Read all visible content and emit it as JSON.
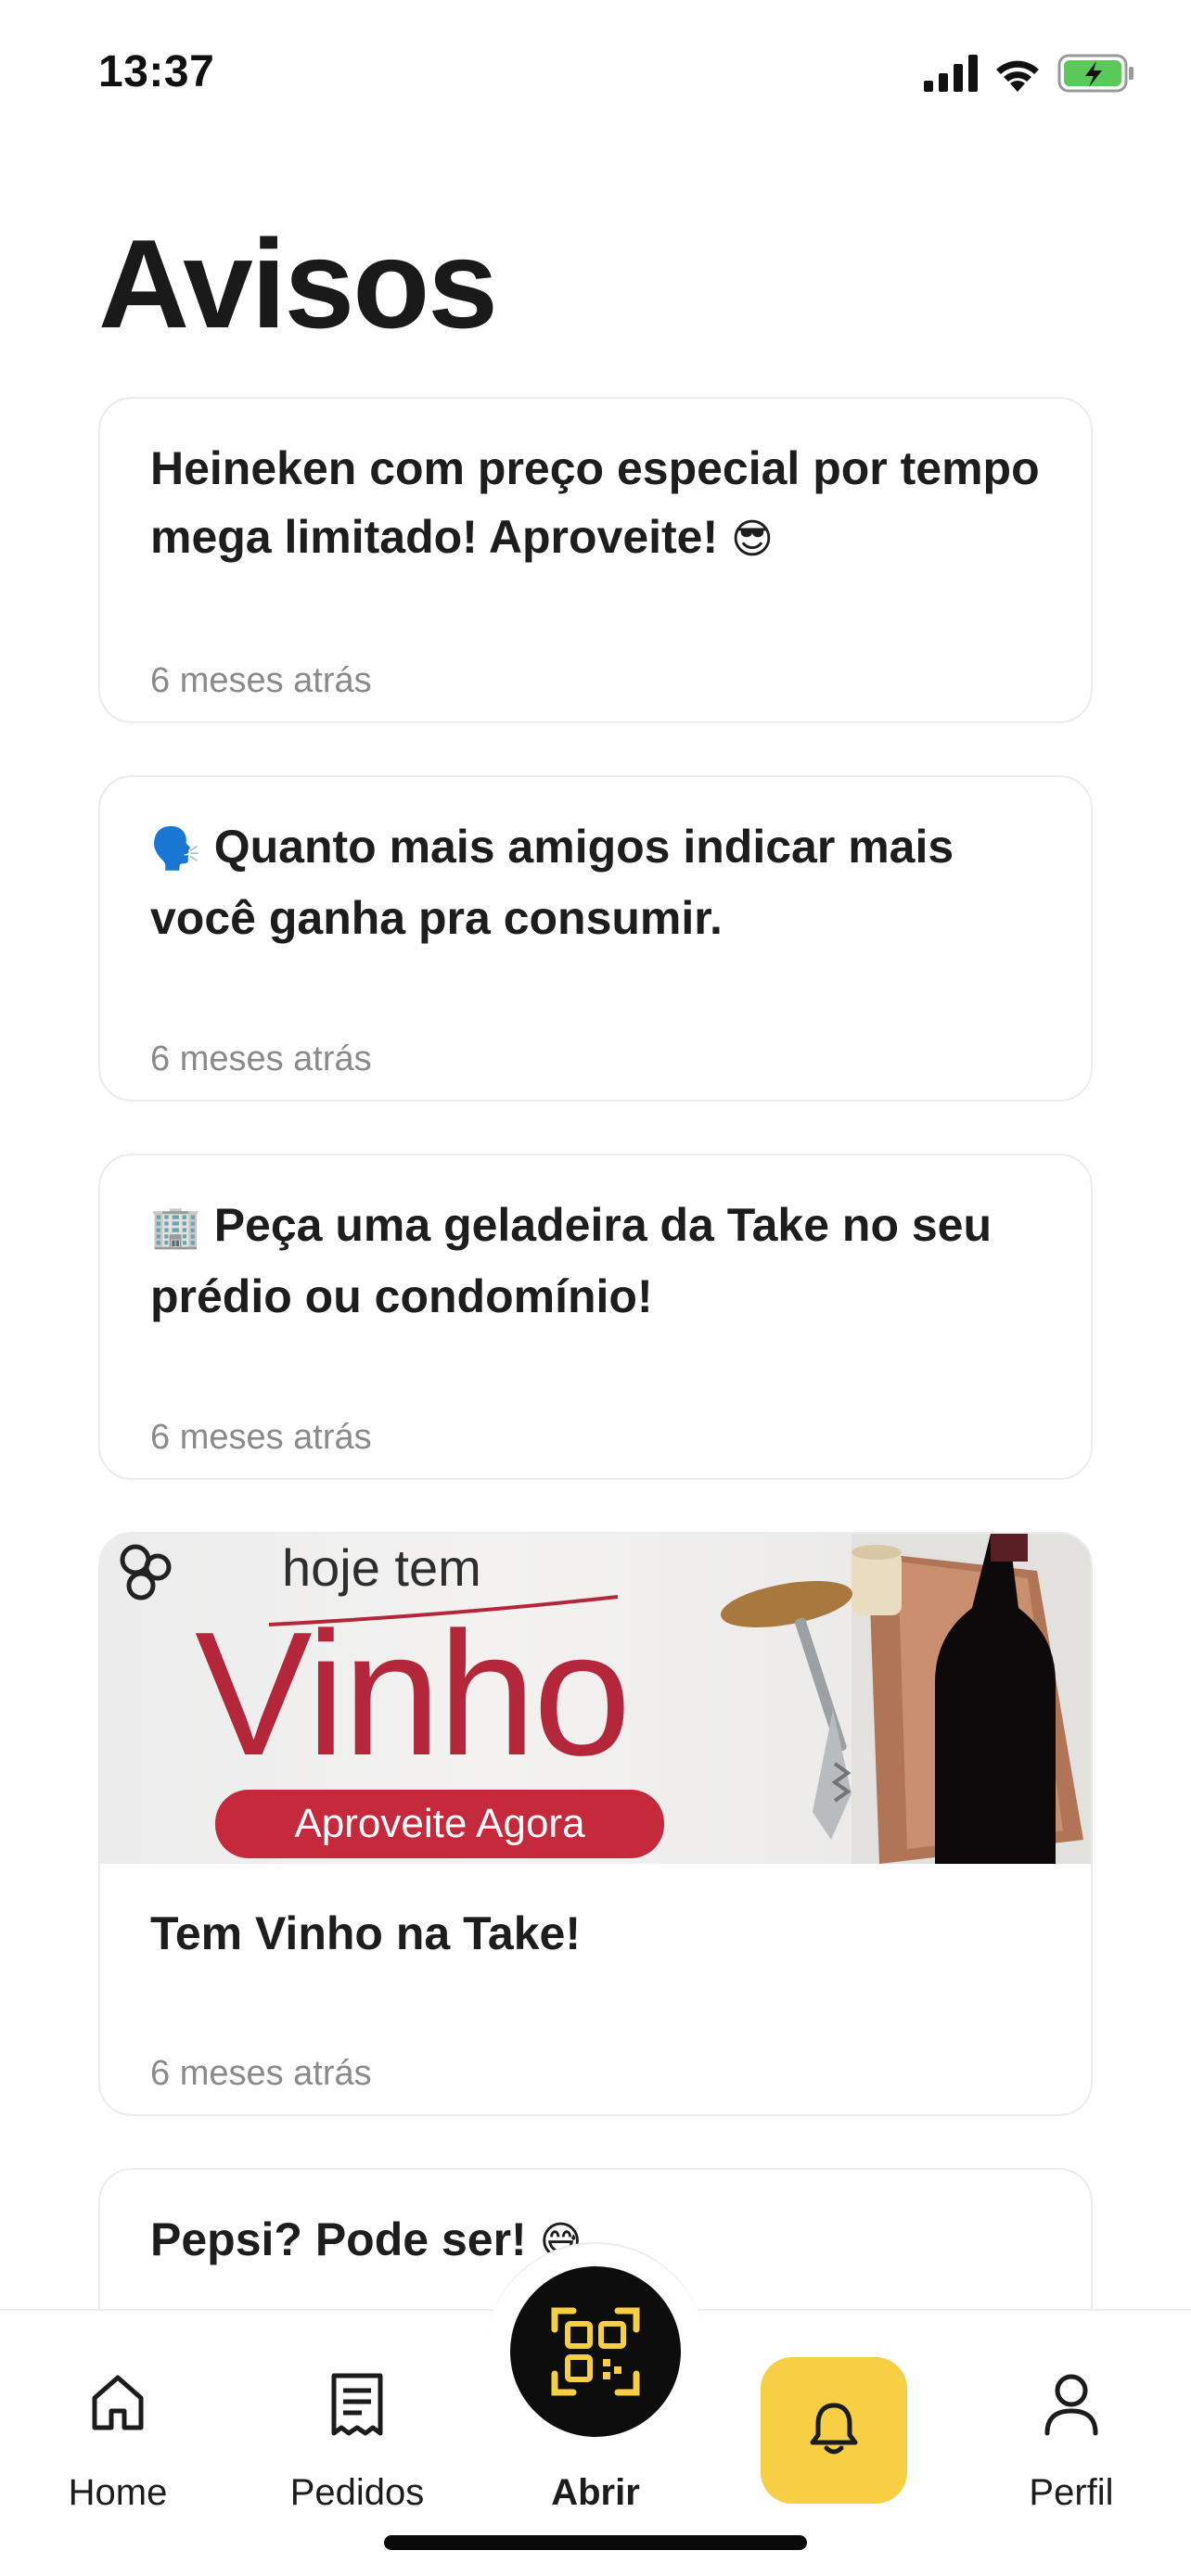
{
  "status_bar": {
    "time": "13:37"
  },
  "page": {
    "title": "Avisos"
  },
  "notices": [
    {
      "title": "Heineken com preço especial por tempo mega limitado! Aproveite!",
      "emoji": "😎",
      "time": "6 meses atrás"
    },
    {
      "emoji": "🗣️",
      "title": "Quanto mais amigos indicar mais você ganha pra consumir.",
      "time": "6 meses atrás"
    },
    {
      "emoji": "🏢",
      "title": "Peça uma geladeira da Take no seu prédio ou condomínio!",
      "time": "6 meses atrás"
    },
    {
      "banner": {
        "line1": "hoje tem",
        "headline": "Vinho",
        "button": "Aproveite Agora"
      },
      "title": "Tem Vinho na Take!",
      "time": "6 meses atrás"
    },
    {
      "title": "Pepsi? Pode ser!",
      "emoji": "😅"
    }
  ],
  "nav": {
    "home": "Home",
    "orders": "Pedidos",
    "open": "Abrir",
    "profile": "Perfil",
    "icons": {
      "home": "house-icon",
      "orders": "receipt-icon",
      "open": "qr-code-icon",
      "notifications": "bell-icon",
      "profile": "person-icon"
    },
    "active": "notifications"
  },
  "colors": {
    "accent": "#f7cf45",
    "dark": "#0d0d0d",
    "banner_red": "#c42a3c"
  }
}
